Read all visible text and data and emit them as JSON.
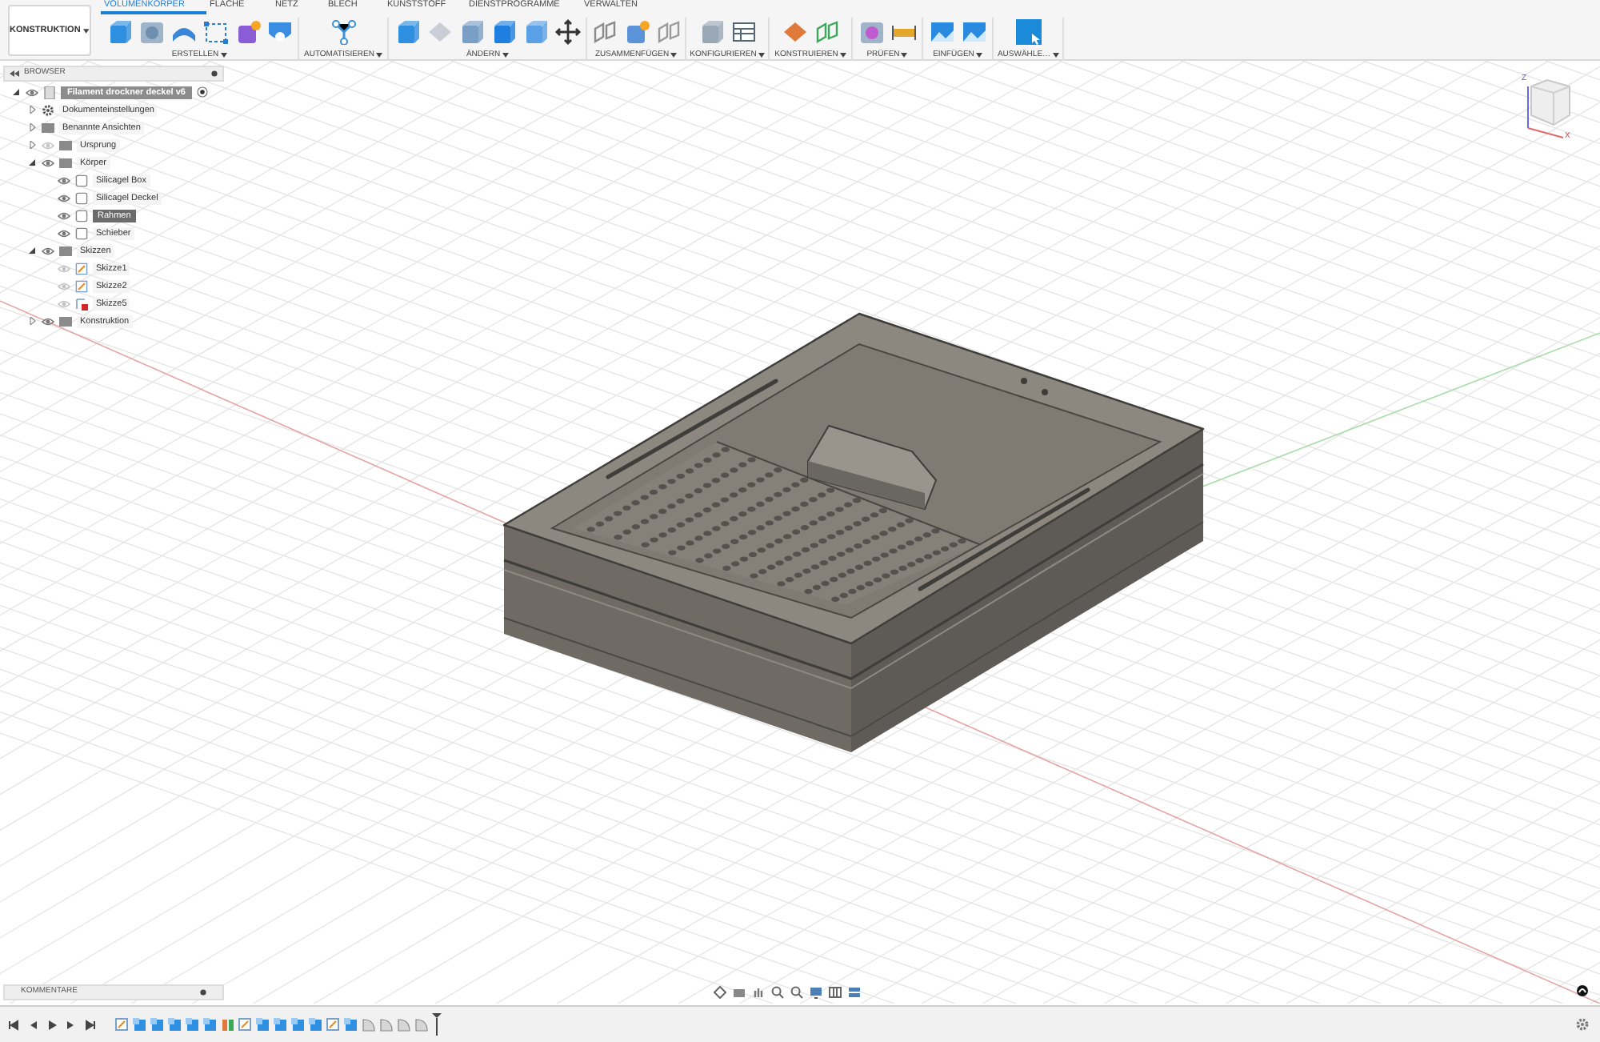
{
  "workspace_button": {
    "label": "KONSTRUKTION"
  },
  "tabs": [
    {
      "label": "VOLUMENKÖRPER",
      "selected": true
    },
    {
      "label": "FLÄCHE",
      "selected": false
    },
    {
      "label": "NETZ",
      "selected": false
    },
    {
      "label": "BLECH",
      "selected": false
    },
    {
      "label": "KUNSTSTOFF",
      "selected": false
    },
    {
      "label": "DIENSTPROGRAMME",
      "selected": false
    },
    {
      "label": "VERWALTEN",
      "selected": false
    }
  ],
  "tool_groups": [
    {
      "label": "ERSTELLEN"
    },
    {
      "label": "AUTOMATISIEREN"
    },
    {
      "label": "ÄNDERN"
    },
    {
      "label": "ZUSAMMENFÜGEN"
    },
    {
      "label": "KONFIGURIEREN"
    },
    {
      "label": "KONSTRUIEREN"
    },
    {
      "label": "PRÜFEN"
    },
    {
      "label": "EINFÜGEN"
    },
    {
      "label": "AUSWÄHLE…"
    }
  ],
  "browser": {
    "title": "BROWSER",
    "tree": [
      {
        "kind": "document",
        "label": "Filament drockner deckel v6",
        "visible": true,
        "expanded": true,
        "children": [
          {
            "kind": "settings",
            "label": "Dokumenteinstellungen",
            "expanded": false,
            "selected": false
          },
          {
            "kind": "views",
            "label": "Benannte Ansichten",
            "expanded": false,
            "selected": false
          },
          {
            "kind": "folder",
            "label": "Ursprung",
            "visible": false,
            "expanded": false,
            "selected": false
          },
          {
            "kind": "folder",
            "label": "Körper",
            "visible": true,
            "expanded": true,
            "selected": false,
            "children": [
              {
                "kind": "body",
                "label": "Silicagel Box",
                "visible": true,
                "selected": false
              },
              {
                "kind": "body",
                "label": "Silicagel Deckel",
                "visible": true,
                "selected": false
              },
              {
                "kind": "body",
                "label": "Rahmen",
                "visible": true,
                "selected": true
              },
              {
                "kind": "body",
                "label": "Schieber",
                "visible": true,
                "selected": false
              }
            ]
          },
          {
            "kind": "folder",
            "label": "Skizzen",
            "visible": true,
            "expanded": true,
            "selected": false,
            "children": [
              {
                "kind": "sketch",
                "label": "Skizze1",
                "visible": false,
                "selected": false
              },
              {
                "kind": "sketch",
                "label": "Skizze2",
                "visible": false,
                "selected": false
              },
              {
                "kind": "sketch_error",
                "label": "Skizze5",
                "visible": false,
                "selected": false
              }
            ]
          },
          {
            "kind": "folder",
            "label": "Konstruktion",
            "visible": true,
            "expanded": false,
            "selected": false
          }
        ]
      }
    ]
  },
  "viewcube": {
    "z_label": "Z",
    "x_label": "X"
  },
  "comments": {
    "title": "KOMMENTARE"
  }
}
